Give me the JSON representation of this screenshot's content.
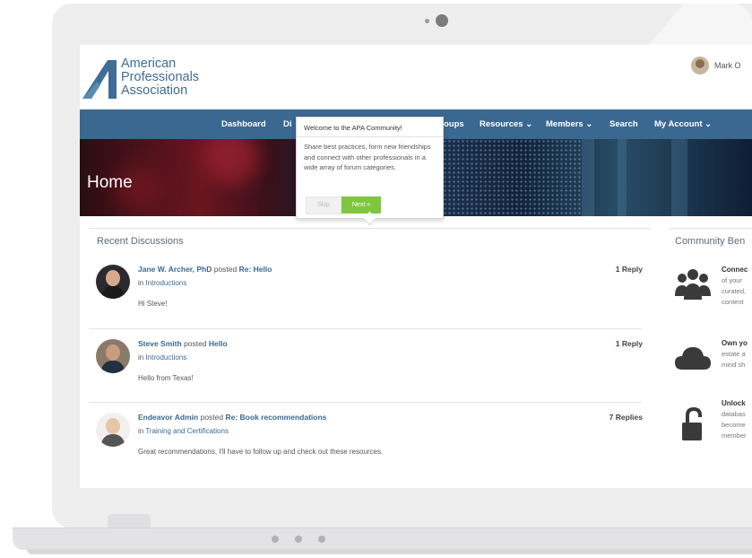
{
  "brand": {
    "logo_lines": [
      "American",
      "Professionals",
      "Association"
    ],
    "logo_color": "#3f6d95"
  },
  "user": {
    "name": "Mark O"
  },
  "nav": {
    "items": [
      {
        "label": "Dashboard"
      },
      {
        "label": "Di"
      },
      {
        "label": "oups"
      },
      {
        "label": "Resources ⌄"
      },
      {
        "label": "Members ⌄"
      },
      {
        "label": "Search"
      },
      {
        "label": "My Account ⌄"
      }
    ],
    "color": "#3b6890"
  },
  "hero": {
    "title": "Home"
  },
  "tour": {
    "title": "Welcome to the APA Community!",
    "body": "Share best practices, form new friendships and connect with other professionals in a wide array of forum categories.",
    "skip_label": "Skip",
    "next_label": "Next »",
    "next_color": "#80c73f"
  },
  "recent": {
    "title": "Recent Discussions",
    "items": [
      {
        "author": "Jane W. Archer, PhD",
        "action": " posted ",
        "subject": "Re: Hello",
        "in_label": "in ",
        "category": "Introductions",
        "message": "Hi Steve!",
        "replies": "1 Reply"
      },
      {
        "author": "Steve Smith",
        "action": " posted ",
        "subject": "Hello",
        "in_label": "in ",
        "category": "Introductions",
        "message": "Hello from Texas!",
        "replies": "1 Reply"
      },
      {
        "author": "Endeavor Admin",
        "action": " posted ",
        "subject": "Re: Book recommendations",
        "in_label": "in ",
        "category": "Training and Certifications",
        "message": "Great recommendations, I'll have to follow up and check out these resources.",
        "replies": "7 Replies"
      }
    ]
  },
  "benefits": {
    "title": "Community Ben",
    "items": [
      {
        "icon": "group-icon",
        "head": "Connec",
        "lines": [
          "of your",
          "curated,",
          "content"
        ]
      },
      {
        "icon": "cloud-icon",
        "head": "Own yo",
        "lines": [
          "estate a",
          "mind sh"
        ]
      },
      {
        "icon": "unlock-icon",
        "head": "Unlock",
        "lines": [
          "databas",
          "become",
          "member"
        ]
      }
    ]
  }
}
